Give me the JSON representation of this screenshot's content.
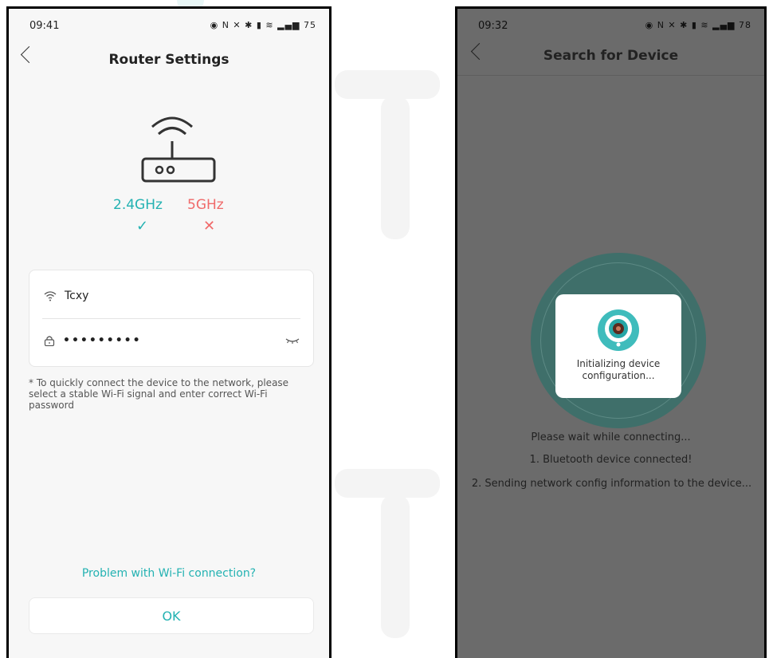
{
  "left_screen": {
    "status_time": "09:41",
    "status_indicators": "◉ N ✕ ✱ ▮ ≋ ▂▄▆ 75",
    "title": "Router Settings",
    "band_24": "2.4GHz",
    "band_5": "5GHz",
    "band_24_mark": "✓",
    "band_5_mark": "✕",
    "ssid": "Tcxy",
    "password_masked": "•••••••••",
    "note": "* To quickly connect the device to the network, please select a stable Wi-Fi signal and enter correct Wi-Fi password",
    "problem_link": "Problem with Wi-Fi connection?",
    "ok_label": "OK"
  },
  "right_screen": {
    "status_time": "09:32",
    "status_indicators": "◉ N ✕ ✱ ▮ ≋ ▂▄▆ 78",
    "title": "Search for Device",
    "dialog_text": "Initializing device configuration...",
    "wait_message": "Please wait while connecting...",
    "step_1": "1. Bluetooth device connected!",
    "step_2": "2. Sending network config information to the device..."
  },
  "colors": {
    "accent": "#23b2b2",
    "error": "#f06a6a",
    "overlay": "#6b6b6b",
    "halo": "#3f6f6a"
  }
}
